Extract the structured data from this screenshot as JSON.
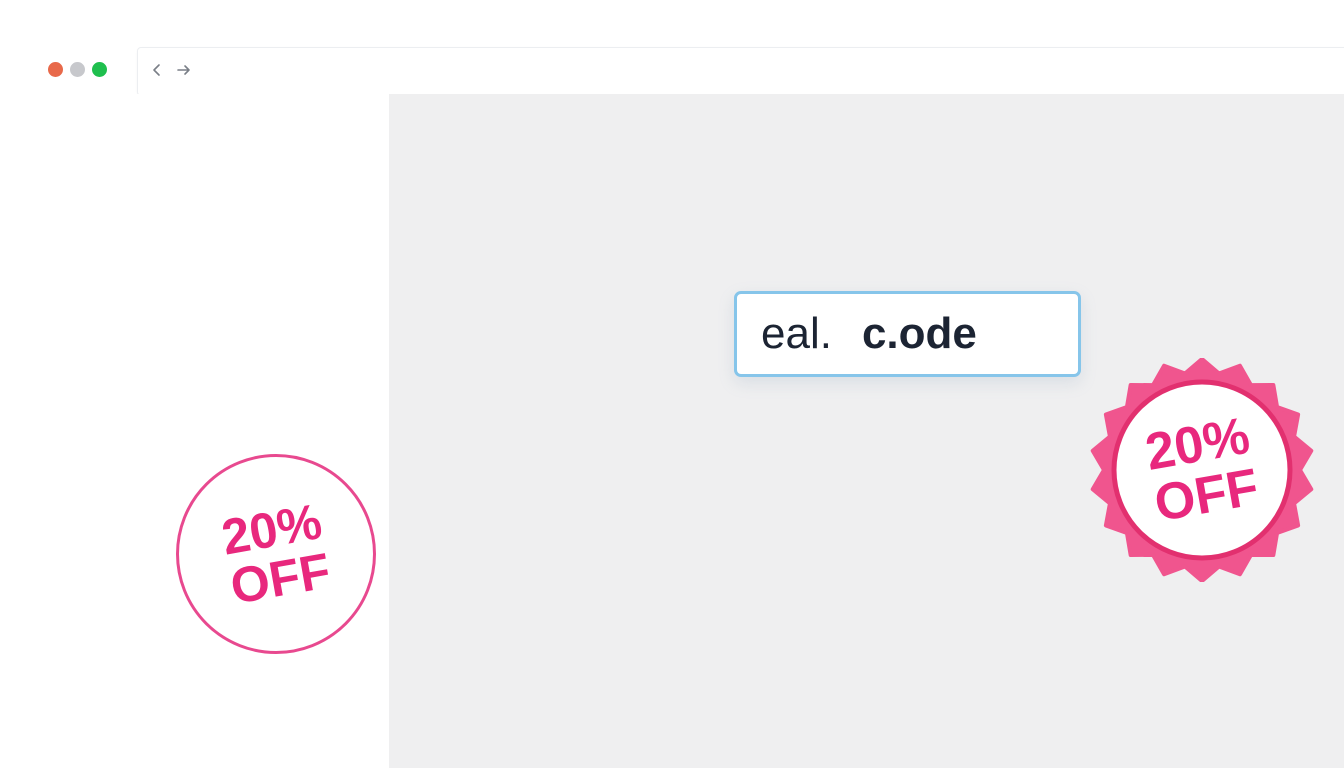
{
  "window": {
    "controls": [
      "close",
      "minimize",
      "maximize"
    ],
    "colors": {
      "close": "#e8694a",
      "minimize": "#c7c8cc",
      "maximize": "#1fbf4e"
    }
  },
  "navigation": {
    "back_icon": "chevron-left-icon",
    "forward_icon": "arrow-right-icon"
  },
  "code_input": {
    "value_part_1": "eal.",
    "value_part_2": "c.ode",
    "border_color": "#86c5ea"
  },
  "badges": {
    "left": {
      "line1": "20%",
      "line2": "OFF",
      "color": "#e8287d"
    },
    "right": {
      "line1": "20%",
      "line2": "OFF",
      "color": "#e8287d"
    }
  }
}
